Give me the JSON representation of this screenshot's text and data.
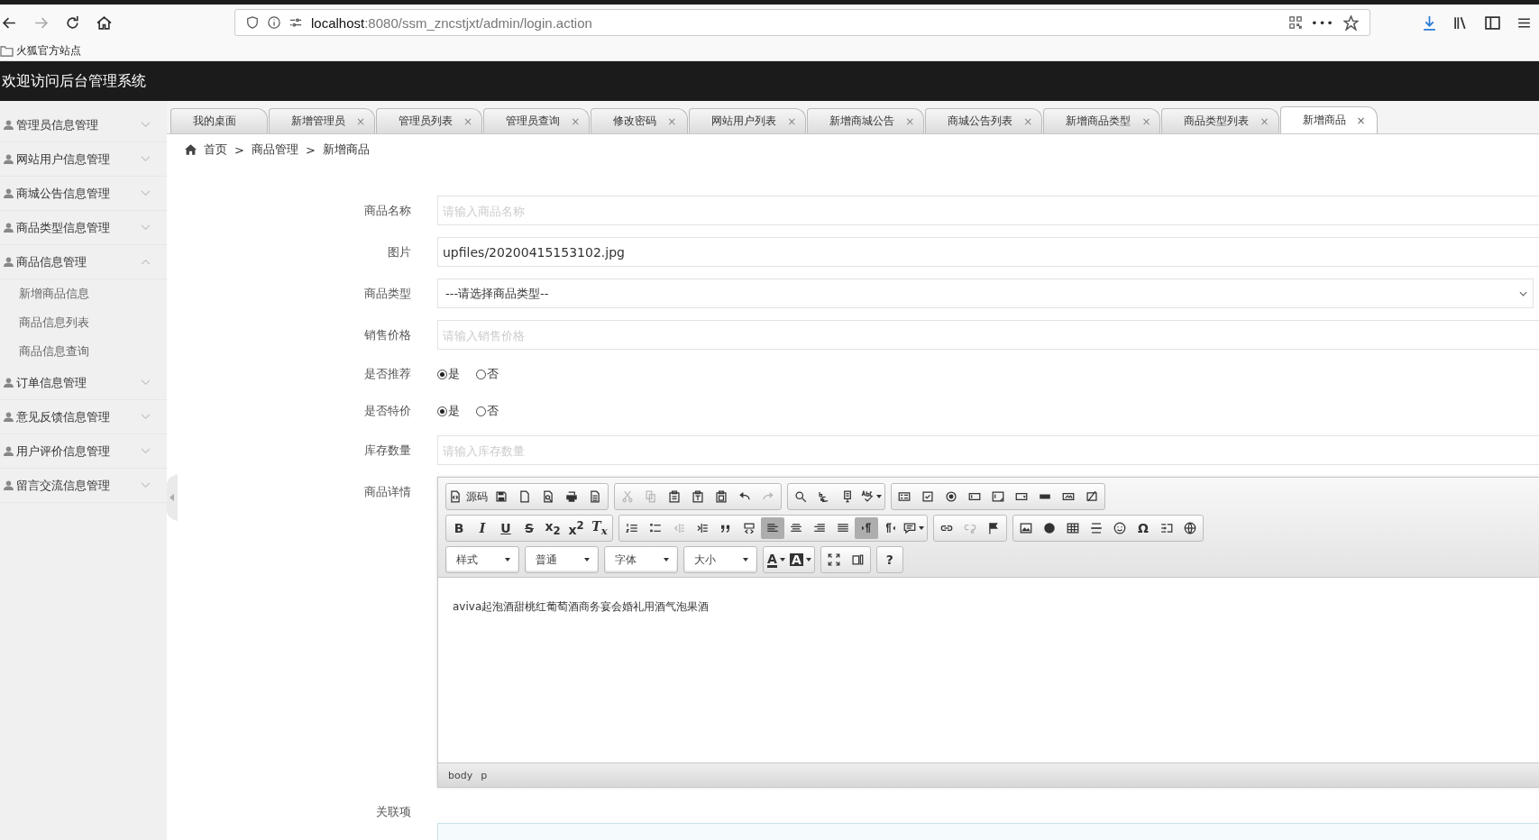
{
  "browser": {
    "url": {
      "host": "localhost",
      "path": ":8080/ssm_zncstjxt/admin/login.action"
    },
    "more": "•••",
    "bookmarks": [
      {
        "label": "火狐官方站点"
      }
    ]
  },
  "header": {
    "title": "欢迎访问后台管理系统"
  },
  "sidebar": {
    "items": [
      {
        "label": "管理员信息管理",
        "expanded": false
      },
      {
        "label": "网站用户信息管理",
        "expanded": false
      },
      {
        "label": "商城公告信息管理",
        "expanded": false
      },
      {
        "label": "商品类型信息管理",
        "expanded": false
      },
      {
        "label": "商品信息管理",
        "expanded": true,
        "children": [
          {
            "label": "新增商品信息"
          },
          {
            "label": "商品信息列表"
          },
          {
            "label": "商品信息查询"
          }
        ]
      },
      {
        "label": "订单信息管理",
        "expanded": false
      },
      {
        "label": "意见反馈信息管理",
        "expanded": false
      },
      {
        "label": "用户评价信息管理",
        "expanded": false
      },
      {
        "label": "留言交流信息管理",
        "expanded": false
      }
    ]
  },
  "tabs": [
    {
      "label": "我的桌面",
      "selected": false
    },
    {
      "label": "新增管理员",
      "selected": false,
      "close": "×"
    },
    {
      "label": "管理员列表",
      "selected": false,
      "close": "×"
    },
    {
      "label": "管理员查询",
      "selected": false,
      "close": "×"
    },
    {
      "label": "修改密码",
      "selected": false,
      "close": "×"
    },
    {
      "label": "网站用户列表",
      "selected": false,
      "close": "×"
    },
    {
      "label": "新增商城公告",
      "selected": false,
      "close": "×"
    },
    {
      "label": "商城公告列表",
      "selected": false,
      "close": "×"
    },
    {
      "label": "新增商品类型",
      "selected": false,
      "close": "×"
    },
    {
      "label": "商品类型列表",
      "selected": false,
      "close": "×"
    },
    {
      "label": "新增商品",
      "selected": true,
      "close": "×"
    }
  ],
  "breadcrumb": [
    {
      "label": "首页"
    },
    {
      "label": "商品管理"
    },
    {
      "label": "新增商品"
    }
  ],
  "breadcrumb_separator": ">",
  "form": {
    "fields": [
      {
        "label": "商品名称",
        "kind": "text",
        "placeholder": "请输入商品名称"
      },
      {
        "label": "图片",
        "kind": "text",
        "value": "upfiles/20200415153102.jpg"
      },
      {
        "label": "商品类型",
        "kind": "select",
        "value": "---请选择商品类型--"
      },
      {
        "label": "销售价格",
        "kind": "text",
        "placeholder": "请输入销售价格"
      },
      {
        "label": "是否推荐",
        "kind": "radio",
        "options": [
          {
            "label": "是",
            "selected": true
          },
          {
            "label": "否",
            "selected": false
          }
        ]
      },
      {
        "label": "是否特价",
        "kind": "radio",
        "options": [
          {
            "label": "是",
            "selected": true
          },
          {
            "label": "否",
            "selected": false
          }
        ]
      },
      {
        "label": "库存数量",
        "kind": "text",
        "placeholder": "请输入库存数量"
      },
      {
        "label": "商品详情",
        "kind": "editor"
      },
      {
        "label": "关联项",
        "kind": "box"
      }
    ]
  },
  "editor": {
    "toolbar": [
      [
        [
          {
            "kind": "source",
            "label": "源码"
          },
          {
            "kind": "save"
          },
          {
            "kind": "newpage"
          },
          {
            "kind": "preview"
          },
          {
            "kind": "print"
          },
          {
            "kind": "templates"
          }
        ],
        [
          {
            "kind": "cut",
            "disabled": true
          },
          {
            "kind": "copy",
            "disabled": true
          },
          {
            "kind": "paste"
          },
          {
            "kind": "pastetext"
          },
          {
            "kind": "pasteword"
          },
          {
            "kind": "undo"
          },
          {
            "kind": "redo",
            "disabled": true
          }
        ],
        [
          {
            "kind": "find"
          },
          {
            "kind": "replace"
          },
          {
            "kind": "selectall"
          },
          {
            "kind": "spell"
          }
        ],
        [
          {
            "kind": "form"
          },
          {
            "kind": "checkbox"
          },
          {
            "kind": "radio"
          },
          {
            "kind": "textfield"
          },
          {
            "kind": "textarea"
          },
          {
            "kind": "select"
          },
          {
            "kind": "button"
          },
          {
            "kind": "imagebutton"
          },
          {
            "kind": "hidden"
          }
        ]
      ],
      [
        [
          {
            "kind": "bold",
            "label": "B"
          },
          {
            "kind": "italic",
            "label": "I"
          },
          {
            "kind": "underline",
            "label": "U"
          },
          {
            "kind": "strike",
            "label": "S"
          },
          {
            "kind": "subscript",
            "label": "x$_{2}$"
          },
          {
            "kind": "superscript",
            "label": "x$^{2}$"
          },
          {
            "kind": "removeformat",
            "label": "T$_{x}$"
          }
        ],
        [
          {
            "kind": "numlist"
          },
          {
            "kind": "bullist"
          },
          {
            "kind": "outdent",
            "disabled": true
          },
          {
            "kind": "indent"
          },
          {
            "kind": "quote"
          },
          {
            "kind": "div"
          },
          {
            "kind": "alignleft",
            "selected": true
          },
          {
            "kind": "aligncenter",
            "selected": false
          },
          {
            "kind": "alignright",
            "selected": false
          },
          {
            "kind": "justify",
            "selected": false
          },
          {
            "kind": "ltr",
            "selected": true
          },
          {
            "kind": "rtl",
            "selected": false
          },
          {
            "kind": "language"
          }
        ],
        [
          {
            "kind": "link"
          },
          {
            "kind": "unlink",
            "disabled": true
          },
          {
            "kind": "anchor"
          }
        ],
        [
          {
            "kind": "image"
          },
          {
            "kind": "flash"
          },
          {
            "kind": "table"
          },
          {
            "kind": "hr"
          },
          {
            "kind": "smiley"
          },
          {
            "kind": "specialchar",
            "label": "Ω"
          },
          {
            "kind": "pagebreak"
          },
          {
            "kind": "iframe"
          }
        ]
      ],
      [
        [
          {
            "kind": "combo",
            "label": "样式"
          }
        ],
        [
          {
            "kind": "combo",
            "label": "普通"
          }
        ],
        [
          {
            "kind": "combo",
            "label": "字体"
          }
        ],
        [
          {
            "kind": "combo",
            "label": "大小"
          }
        ],
        [
          {
            "kind": "textcolor",
            "label": "A"
          },
          {
            "kind": "bgcolor",
            "label": "A"
          }
        ],
        [
          {
            "kind": "maximize"
          },
          {
            "kind": "showblocks"
          }
        ],
        [
          {
            "kind": "about",
            "label": "?"
          }
        ]
      ]
    ],
    "content": "aviva起泡酒甜桃红葡萄酒商务宴会婚礼用酒气泡果酒",
    "path": [
      "body",
      "p"
    ]
  }
}
